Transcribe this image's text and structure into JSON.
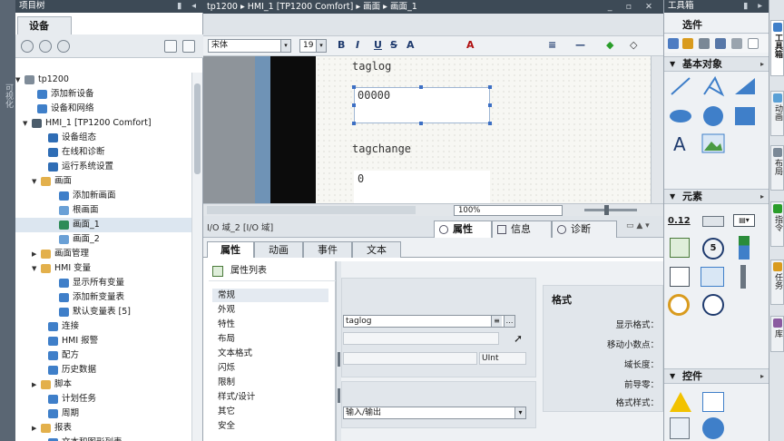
{
  "left_strip": {
    "label": "可视化"
  },
  "project_tree": {
    "panel_title": "项目树",
    "tab": "设备",
    "items": [
      {
        "label": "tp1200",
        "arrow": "▼",
        "color": "#7f8c99"
      },
      {
        "label": "添加新设备",
        "arrow": "",
        "color": "#3f7fc9"
      },
      {
        "label": "设备和网络",
        "arrow": "",
        "color": "#3f7fc9"
      },
      {
        "label": "HMI_1 [TP1200 Comfort]",
        "arrow": "▼",
        "color": "#4b5c6b"
      },
      {
        "label": "设备组态",
        "arrow": "",
        "color": "#2f6db5"
      },
      {
        "label": "在线和诊断",
        "arrow": "",
        "color": "#2f6db5"
      },
      {
        "label": "运行系统设置",
        "arrow": "",
        "color": "#2f6db5"
      },
      {
        "label": "画面",
        "arrow": "▼",
        "color": "#e3b04b"
      },
      {
        "label": "添加新画面",
        "arrow": "",
        "color": "#3f7fc9"
      },
      {
        "label": "根画面",
        "arrow": "",
        "color": "#6aa0d6"
      },
      {
        "label": "画面_1",
        "arrow": "",
        "color": "#2e8b57"
      },
      {
        "label": "画面_2",
        "arrow": "",
        "color": "#6aa0d6"
      },
      {
        "label": "画面管理",
        "arrow": "▶",
        "color": "#e3b04b"
      },
      {
        "label": "HMI 变量",
        "arrow": "▼",
        "color": "#e3b04b"
      },
      {
        "label": "显示所有变量",
        "arrow": "",
        "color": "#3f7fc9"
      },
      {
        "label": "添加新变量表",
        "arrow": "",
        "color": "#3f7fc9"
      },
      {
        "label": "默认变量表 [5]",
        "arrow": "",
        "color": "#3f7fc9"
      },
      {
        "label": "连接",
        "arrow": "",
        "color": "#3f7fc9"
      },
      {
        "label": "HMI 报警",
        "arrow": "",
        "color": "#3f7fc9"
      },
      {
        "label": "配方",
        "arrow": "",
        "color": "#3f7fc9"
      },
      {
        "label": "历史数据",
        "arrow": "",
        "color": "#3f7fc9"
      },
      {
        "label": "脚本",
        "arrow": "▶",
        "color": "#e3b04b"
      },
      {
        "label": "计划任务",
        "arrow": "",
        "color": "#3f7fc9"
      },
      {
        "label": "周期",
        "arrow": "",
        "color": "#3f7fc9"
      },
      {
        "label": "报表",
        "arrow": "▶",
        "color": "#e3b04b"
      },
      {
        "label": "文本和图形列表",
        "arrow": "",
        "color": "#3f7fc9"
      }
    ]
  },
  "editor": {
    "breadcrumb": "tp1200  ▸  HMI_1 [TP1200 Comfort]  ▸  画面  ▸  画面_1",
    "font": "宋体",
    "font_size": "19",
    "format_buttons": [
      "B",
      "I",
      "U",
      "S",
      "A",
      "A",
      "≡",
      "—",
      "◆",
      "◇"
    ],
    "canvas": {
      "label_taglog": "taglog",
      "field_taglog_value": "00000",
      "label_tagchange": "tagchange",
      "field_tagchange_value": "0"
    },
    "zoom": "100%"
  },
  "inspector": {
    "object_name": "I/O 域_2 [I/O 域]",
    "top_tabs": [
      "属性",
      "信息",
      "诊断"
    ],
    "sub_tabs": [
      "属性",
      "动画",
      "事件",
      "文本"
    ],
    "property_list_title": "属性列表",
    "property_items": [
      "常规",
      "外观",
      "特性",
      "布局",
      "文本格式",
      "闪烁",
      "限制",
      "样式/设计",
      "其它",
      "安全"
    ],
    "process_tag": "taglog",
    "data_type": "UInt",
    "mode": "输入/输出",
    "format_heading": "格式",
    "format_labels": [
      "显示格式：",
      "移动小数点：",
      "域长度：",
      "前导零：",
      "格式样式："
    ]
  },
  "toolbox": {
    "panel_title": "工具箱",
    "sections": [
      "选件",
      "基本对象",
      "元素",
      "控件"
    ],
    "basic_objects": [
      "line-tool",
      "polyline-tool",
      "polygon-tool",
      "ellipse-tool",
      "circle-tool",
      "rectangle-tool",
      "text-tool",
      "graphic-view-tool"
    ],
    "elements": [
      "io-field-tool",
      "button-tool",
      "symbolic-io-tool",
      "graphic-io-tool",
      "datetime-tool",
      "bar-tool",
      "switch-tool",
      "slider-tool",
      "gauge-tool",
      "clock-tool"
    ],
    "element_io_text": "0.12",
    "text_tool_glyph": "A"
  },
  "right_tabs": [
    "工具箱",
    "动画",
    "布局",
    "指令",
    "任务",
    "库"
  ],
  "colors": {
    "title_bar": "#3d4a56",
    "accent": "#1f3b6e",
    "selection": "#dce6f0"
  }
}
